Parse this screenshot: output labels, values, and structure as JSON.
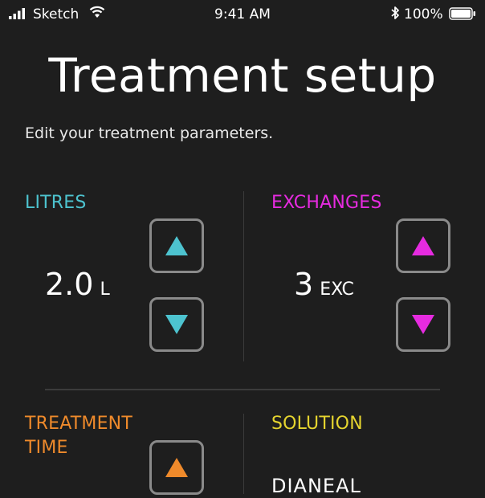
{
  "status_bar": {
    "carrier": "Sketch",
    "time": "9:41 AM",
    "battery": "100%"
  },
  "page": {
    "title": "Treatment setup",
    "subtitle": "Edit your treatment parameters."
  },
  "litres": {
    "label": "LITRES",
    "value": "2.0",
    "unit": "L",
    "color": "#4dc3cf"
  },
  "exchanges": {
    "label": "EXCHANGES",
    "value": "3",
    "unit": "EXC",
    "color": "#e62be0"
  },
  "treatment_time": {
    "label": "TREATMENT TIME",
    "color": "#ef8a2b"
  },
  "solution": {
    "label": "SOLUTION",
    "value": "DIANEAL",
    "color": "#e5d42f"
  },
  "icons": {
    "signal": "cellular-signal-icon",
    "wifi": "wifi-icon",
    "bluetooth": "bluetooth-icon",
    "battery": "battery-icon",
    "increment": "triangle-up-icon",
    "decrement": "triangle-down-icon"
  }
}
